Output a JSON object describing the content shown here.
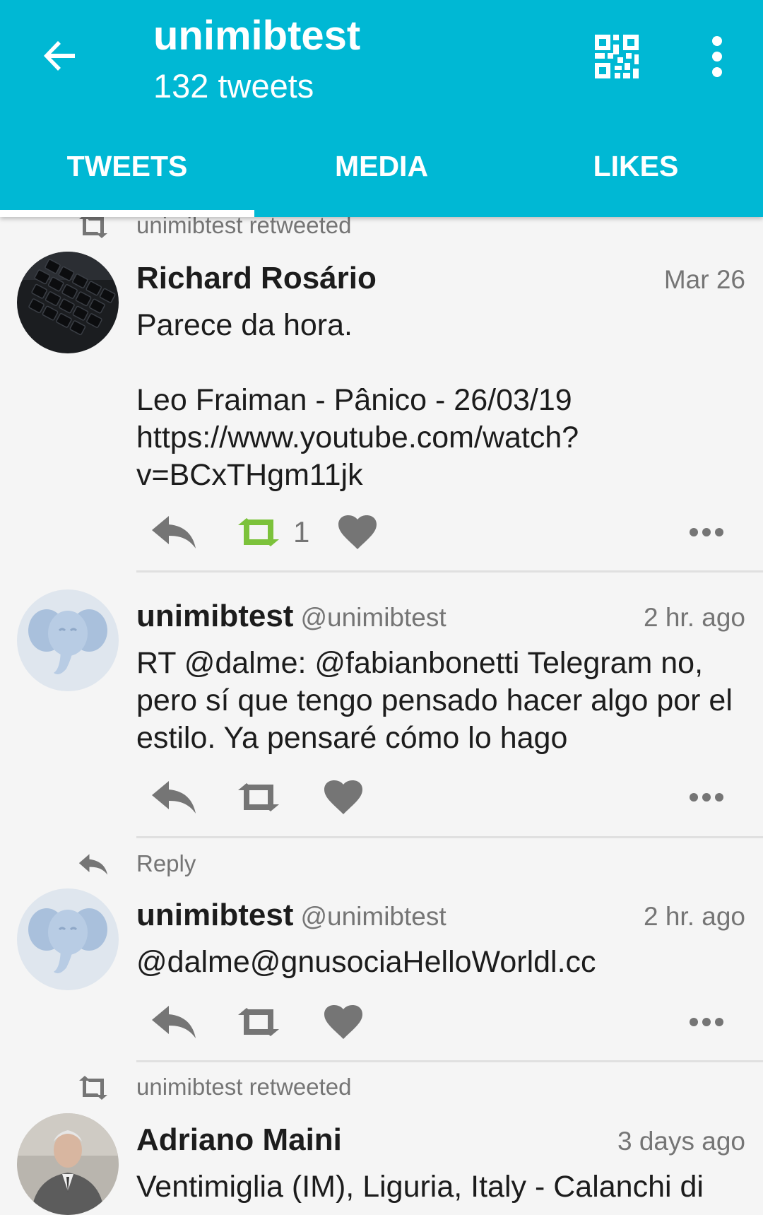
{
  "header": {
    "title": "unimibtest",
    "subtitle": "132 tweets",
    "back_icon": "arrow-back-icon",
    "qr_icon": "qr-code-icon",
    "menu_icon": "more-vert-icon",
    "bg_color": "#00b8d4"
  },
  "tabs": [
    {
      "label": "TWEETS",
      "active": true
    },
    {
      "label": "MEDIA",
      "active": false
    },
    {
      "label": "LIKES",
      "active": false
    }
  ],
  "tweets": [
    {
      "context": "unimibtest retweeted",
      "context_icon": "retweet-icon",
      "name": "Richard Rosário",
      "handle": "",
      "time": "Mar 26",
      "text": "Parece da hora.\n\nLeo Fraiman - Pânico - 26/03/19\nhttps://www.youtube.com/watch?v=BCxTHgm11jk",
      "retweet_count": "1",
      "retweeted": true
    },
    {
      "context": "",
      "name": "unimibtest",
      "handle": "@unimibtest",
      "time": "2 hr. ago",
      "text": "RT @dalme: @fabianbonetti Telegram no, pero sí que tengo pensado hacer algo por el estilo. Ya pensaré cómo lo hago",
      "retweet_count": "",
      "retweeted": false
    },
    {
      "context": "Reply",
      "context_icon": "reply-icon",
      "name": "unimibtest",
      "handle": "@unimibtest",
      "time": "2 hr. ago",
      "text": "@dalme@gnusociaHelloWorldl.cc",
      "retweet_count": "",
      "retweeted": false
    },
    {
      "context": "unimibtest retweeted",
      "context_icon": "retweet-icon",
      "name": "Adriano Maini",
      "handle": "",
      "time": "3 days ago",
      "text": "Ventimiglia (IM), Liguria, Italy - Calanchi di"
    }
  ],
  "colors": {
    "accent": "#00b8d4",
    "retweet_active": "#7cc23b",
    "icon_gray": "#757575"
  }
}
